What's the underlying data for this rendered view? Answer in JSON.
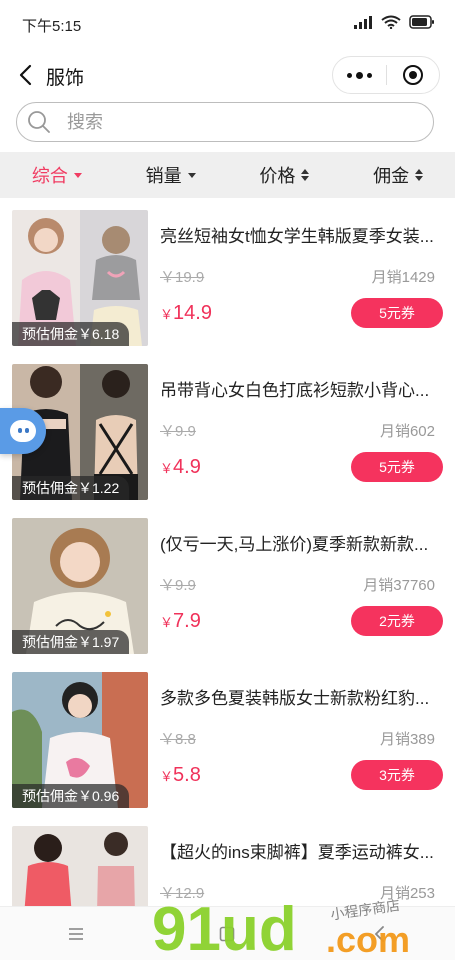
{
  "status_bar": {
    "time": "下午5:15"
  },
  "nav": {
    "title": "服饰"
  },
  "search": {
    "placeholder": "搜索"
  },
  "sort_tabs": [
    {
      "label": "综合",
      "active": true
    },
    {
      "label": "销量"
    },
    {
      "label": "价格"
    },
    {
      "label": "佣金"
    }
  ],
  "products": [
    {
      "title": "亮丝短袖女t恤女学生韩版夏季女装...",
      "commission": "预估佣金￥6.18",
      "original_price": "￥19.9",
      "sales": "月销1429",
      "price_symbol": "￥",
      "price": "14.9",
      "coupon": "5元券"
    },
    {
      "title": "吊带背心女白色打底衫短款小背心...",
      "commission": "预估佣金￥1.22",
      "original_price": "￥9.9",
      "sales": "月销602",
      "price_symbol": "￥",
      "price": "4.9",
      "coupon": "5元券"
    },
    {
      "title": "(仅亏一天,马上涨价)夏季新款新款...",
      "commission": "预估佣金￥1.97",
      "original_price": "￥9.9",
      "sales": "月销37760",
      "price_symbol": "￥",
      "price": "7.9",
      "coupon": "2元券"
    },
    {
      "title": "多款多色夏装韩版女士新款粉红豹...",
      "commission": "预估佣金￥0.96",
      "original_price": "￥8.8",
      "sales": "月销389",
      "price_symbol": "￥",
      "price": "5.8",
      "coupon": "3元券"
    },
    {
      "title": "【超火的ins束脚裤】夏季运动裤女...",
      "original_price": "￥12.9",
      "sales": "月销253"
    }
  ],
  "watermark": {
    "brand": "91ud",
    "domain": ".com",
    "tagline": "小程序商店"
  },
  "colors": {
    "accent": "#f03c62",
    "coupon_bg": "#f5335e"
  }
}
